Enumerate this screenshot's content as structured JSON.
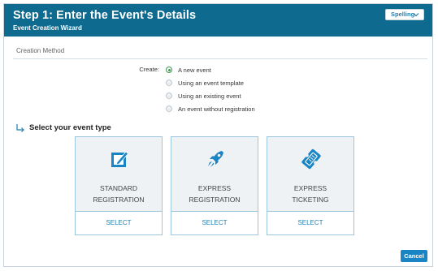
{
  "header": {
    "title": "Step 1: Enter the Event's Details",
    "subtitle": "Event Creation Wizard",
    "spelling_label": "Spelling"
  },
  "creation": {
    "section_label": "Creation Method",
    "create_label": "Create:",
    "options": [
      {
        "label": "A new event",
        "selected": true
      },
      {
        "label": "Using an event template",
        "selected": false
      },
      {
        "label": "Using an existing event",
        "selected": false
      },
      {
        "label": "An event without registration",
        "selected": false
      }
    ]
  },
  "event_type": {
    "heading": "Select your event type",
    "cards": [
      {
        "line1": "STANDARD",
        "line2": "REGISTRATION",
        "select": "SELECT",
        "icon": "edit-square-icon"
      },
      {
        "line1": "EXPRESS",
        "line2": "REGISTRATION",
        "select": "SELECT",
        "icon": "rocket-icon"
      },
      {
        "line1": "EXPRESS",
        "line2": "TICKETING",
        "select": "SELECT",
        "icon": "ticket-icon"
      }
    ]
  },
  "footer": {
    "cancel_label": "Cancel"
  },
  "colors": {
    "header_bg": "#0e6a8e",
    "accent": "#1a85c4",
    "radio_selected": "#3a9a4c"
  }
}
